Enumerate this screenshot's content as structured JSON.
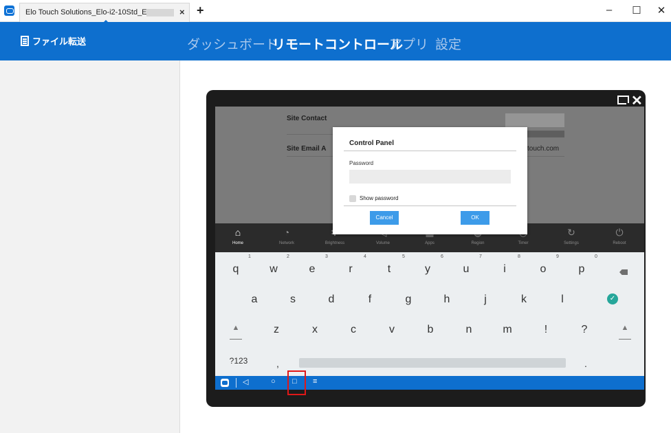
{
  "window": {
    "tab_title": "Elo Touch Solutions_Elo-i2-10Std_E",
    "tab_close": "×",
    "new_tab": "+",
    "minimize": "–",
    "maximize": "☐",
    "close": "✕"
  },
  "header": {
    "file_transfer": "ファイル転送",
    "nav": [
      "ダッシュボード",
      "リモートコントロール",
      "アプリ",
      "設定"
    ],
    "active_nav": "リモートコントロール",
    "accent_color": "#0e6fce"
  },
  "device_view": {
    "close": "✕",
    "site_contact_label": "Site Contact",
    "site_email_label": "Site Email A",
    "email_tail": "touch.com",
    "quick_settings": [
      {
        "icon": "home-icon",
        "glyph": "⌂",
        "label": "Home"
      },
      {
        "icon": "wifi-icon",
        "glyph": "◔",
        "label": "Network"
      },
      {
        "icon": "brightness-icon",
        "glyph": "✻",
        "label": "Brightness"
      },
      {
        "icon": "volume-icon",
        "glyph": "◁",
        "label": "Volume"
      },
      {
        "icon": "apps-icon",
        "glyph": "▦",
        "label": "Apps"
      },
      {
        "icon": "region-icon",
        "glyph": "◍",
        "label": "Region"
      },
      {
        "icon": "timer-icon",
        "glyph": "◷",
        "label": "Timer"
      },
      {
        "icon": "settings-icon",
        "glyph": "↻",
        "label": "Settings"
      },
      {
        "icon": "reboot-icon",
        "glyph": "⏻",
        "label": "Reboot"
      }
    ]
  },
  "dialog": {
    "title": "Control Panel",
    "password_label": "Password",
    "show_password_label": "Show password",
    "cancel": "Cancel",
    "ok": "OK",
    "button_color": "#3d9be9"
  },
  "keyboard": {
    "row1": [
      "q",
      "w",
      "e",
      "r",
      "t",
      "y",
      "u",
      "i",
      "o",
      "p"
    ],
    "row1_numbers": [
      "1",
      "2",
      "3",
      "4",
      "5",
      "6",
      "7",
      "8",
      "9",
      "0"
    ],
    "row2": [
      "a",
      "s",
      "d",
      "f",
      "g",
      "h",
      "j",
      "k",
      "l"
    ],
    "row3": [
      "z",
      "x",
      "c",
      "v",
      "b",
      "n",
      "m",
      "!",
      "?"
    ],
    "shift": "▲",
    "symbols_key": "?123",
    "comma": ",",
    "period": ".",
    "enter": "✓",
    "enter_color": "#26a69a"
  },
  "android_nav": {
    "back": "◁",
    "home": "○",
    "recents": "□",
    "menu": "≡"
  }
}
